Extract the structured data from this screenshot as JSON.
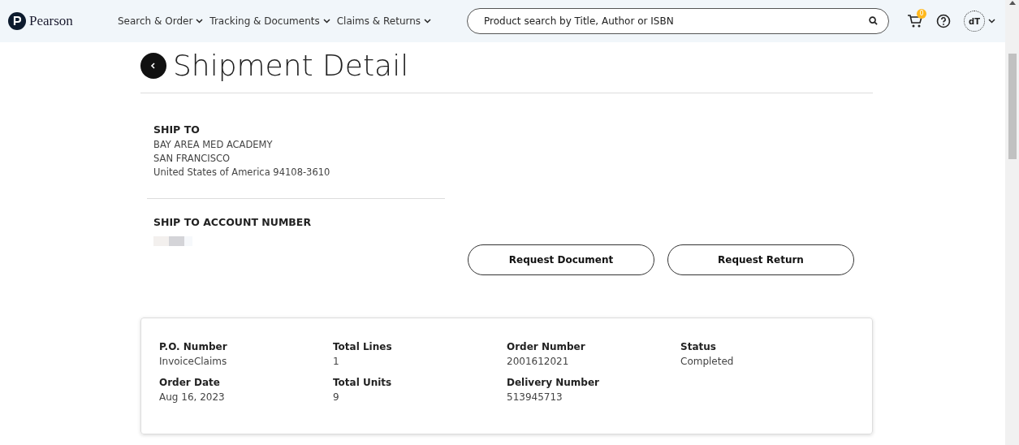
{
  "header": {
    "logo": "Pearson",
    "menus": [
      {
        "label": "Search & Order"
      },
      {
        "label": "Tracking & Documents"
      },
      {
        "label": "Claims & Returns"
      }
    ],
    "search": {
      "placeholder": "Product search by Title, Author or ISBN"
    },
    "cart_count": "0",
    "avatar": "dT"
  },
  "page": {
    "title": "Shipment Detail",
    "ship_to": {
      "heading": "SHIP TO",
      "lines": [
        "BAY AREA MED ACADEMY",
        "SAN FRANCISCO",
        "United States of America 94108-3610"
      ]
    },
    "account": {
      "heading": "SHIP TO ACCOUNT NUMBER"
    },
    "buttons": [
      "Request Document",
      "Request Return"
    ],
    "summary": [
      {
        "label": "P.O. Number",
        "value": "InvoiceClaims"
      },
      {
        "label": "Total Lines",
        "value": "1"
      },
      {
        "label": "Order Number",
        "value": "2001612021"
      },
      {
        "label": "Status",
        "value": "Completed"
      },
      {
        "label": "Order Date",
        "value": "Aug 16, 2023"
      },
      {
        "label": "Total Units",
        "value": "9"
      },
      {
        "label": "Delivery Number",
        "value": "513945713"
      }
    ]
  }
}
